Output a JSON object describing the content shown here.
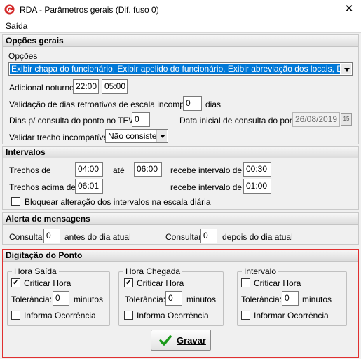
{
  "window": {
    "title": "RDA - Parâmetros gerais (Dif. fuso 0)",
    "close_glyph": "✕"
  },
  "menu": {
    "saida": "Saída"
  },
  "opcoes_gerais": {
    "header": "Opções gerais",
    "opcoes_label": "Opções",
    "opcoes_value": "Exibir chapa do funcionário, Exibir apelido do funcionário, Exibir abreviação dos locais, Descontar in",
    "adicional_noturno_label": "Adicional noturno",
    "adicional_inicio": "22:00",
    "adicional_fim": "05:00",
    "validacao_label": "Validação de dias retroativos de escala incompleta:",
    "validacao_value": "0",
    "validacao_unit": "dias",
    "dias_consulta_label": "Dias p/ consulta do ponto no TEW:",
    "dias_consulta_value": "0",
    "data_inicial_label": "Data inicial de consulta do ponto:",
    "data_inicial_value": "26/08/2019",
    "calendar_glyph": "15",
    "validar_trecho_label": "Validar trecho incompatível:",
    "validar_trecho_value": "Não consiste"
  },
  "intervalos": {
    "header": "Intervalos",
    "trechos_de_label": "Trechos de",
    "trechos_de_value": "04:00",
    "ate_label": "até",
    "ate_value": "06:00",
    "recebe1_label": "recebe intervalo de",
    "recebe1_value": "00:30",
    "trechos_acima_label": "Trechos acima de",
    "trechos_acima_value": "06:01",
    "recebe2_label": "recebe intervalo de",
    "recebe2_value": "01:00",
    "bloquear_label": "Bloquear alteração dos intervalos na escala diária",
    "bloquear_checked": false
  },
  "alerta": {
    "header": "Alerta de mensagens",
    "consultar1_label": "Consultar",
    "consultar1_value": "0",
    "antes_label": "antes do dia atual",
    "consultar2_label": "Consultar",
    "consultar2_value": "0",
    "depois_label": "depois do dia atual"
  },
  "digitacao": {
    "header": "Digitação do Ponto",
    "highlight_color": "#e03030",
    "hora_saida": {
      "title": "Hora Saída",
      "criticar_label": "Criticar Hora",
      "criticar_checked": true,
      "tolerancia_label": "Tolerância:",
      "tolerancia_value": "0",
      "minutos_label": "minutos",
      "ocorrencia_label": "Informa Ocorrência",
      "ocorrencia_checked": false
    },
    "hora_chegada": {
      "title": "Hora Chegada",
      "criticar_label": "Criticar Hora",
      "criticar_checked": true,
      "tolerancia_label": "Tolerância:",
      "tolerancia_value": "0",
      "minutos_label": "minutos",
      "ocorrencia_label": "Informa Ocorrência",
      "ocorrencia_checked": false
    },
    "intervalo": {
      "title": "Intervalo",
      "criticar_label": "Criticar Hora",
      "criticar_checked": false,
      "tolerancia_label": "Tolerância:",
      "tolerancia_value": "0",
      "minutos_label": "minutos",
      "ocorrencia_label": "Informar Ocorrência",
      "ocorrencia_checked": false
    }
  },
  "footer": {
    "gravar_label": "Gravar",
    "check_icon_color": "#1a9a1a"
  },
  "icons": {
    "app": "app-logo-icon",
    "calendar": "calendar-icon",
    "dropdown": "chevron-down-icon",
    "check": "checkmark-icon",
    "close": "close-icon"
  }
}
